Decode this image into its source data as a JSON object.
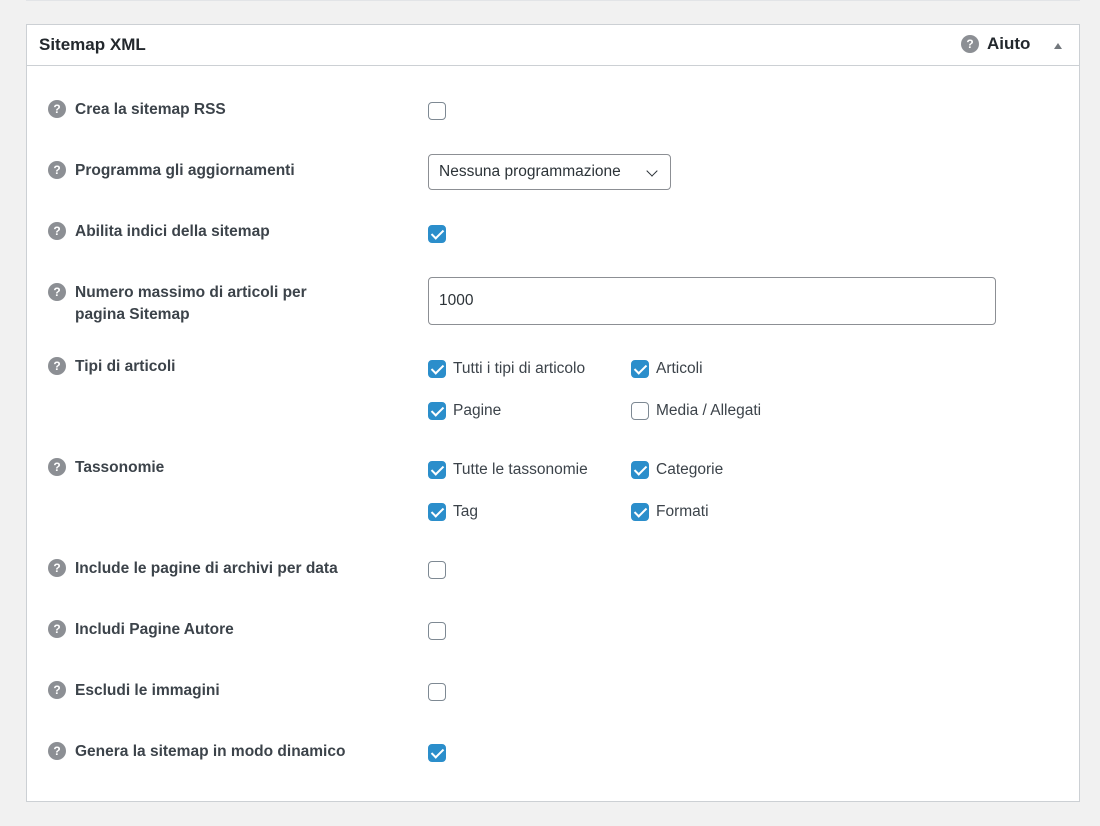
{
  "panel": {
    "title": "Sitemap XML",
    "help_label": "Aiuto"
  },
  "settings": {
    "rss": {
      "label": "Crea la sitemap RSS",
      "checked": false
    },
    "schedule": {
      "label": "Programma gli aggiornamenti",
      "value": "Nessuna programmazione"
    },
    "indexes": {
      "label": "Abilita indici della sitemap",
      "checked": true
    },
    "max_posts": {
      "label_line1": "Numero massimo di articoli per",
      "label_line2": "pagina Sitemap",
      "value": "1000"
    },
    "post_types": {
      "label": "Tipi di articoli",
      "options": [
        {
          "label": "Tutti i tipi di articolo",
          "checked": true
        },
        {
          "label": "Articoli",
          "checked": true
        },
        {
          "label": "Pagine",
          "checked": true
        },
        {
          "label": "Media / Allegati",
          "checked": false
        }
      ]
    },
    "taxonomies": {
      "label": "Tassonomie",
      "options": [
        {
          "label": "Tutte le tassonomie",
          "checked": true
        },
        {
          "label": "Categorie",
          "checked": true
        },
        {
          "label": "Tag",
          "checked": true
        },
        {
          "label": "Formati",
          "checked": true
        }
      ]
    },
    "date_archives": {
      "label": "Include le pagine di archivi per data",
      "checked": false
    },
    "author_pages": {
      "label": "Includi Pagine Autore",
      "checked": false
    },
    "exclude_images": {
      "label": "Escludi le immagini",
      "checked": false
    },
    "dynamic": {
      "label": "Genera la sitemap in modo dinamico",
      "checked": true
    }
  },
  "icons": {
    "help": "question-mark-icon",
    "collapse": "triangle-up-icon"
  },
  "colors": {
    "accent": "#2b8ecb",
    "help_icon": "#8c8f94"
  }
}
